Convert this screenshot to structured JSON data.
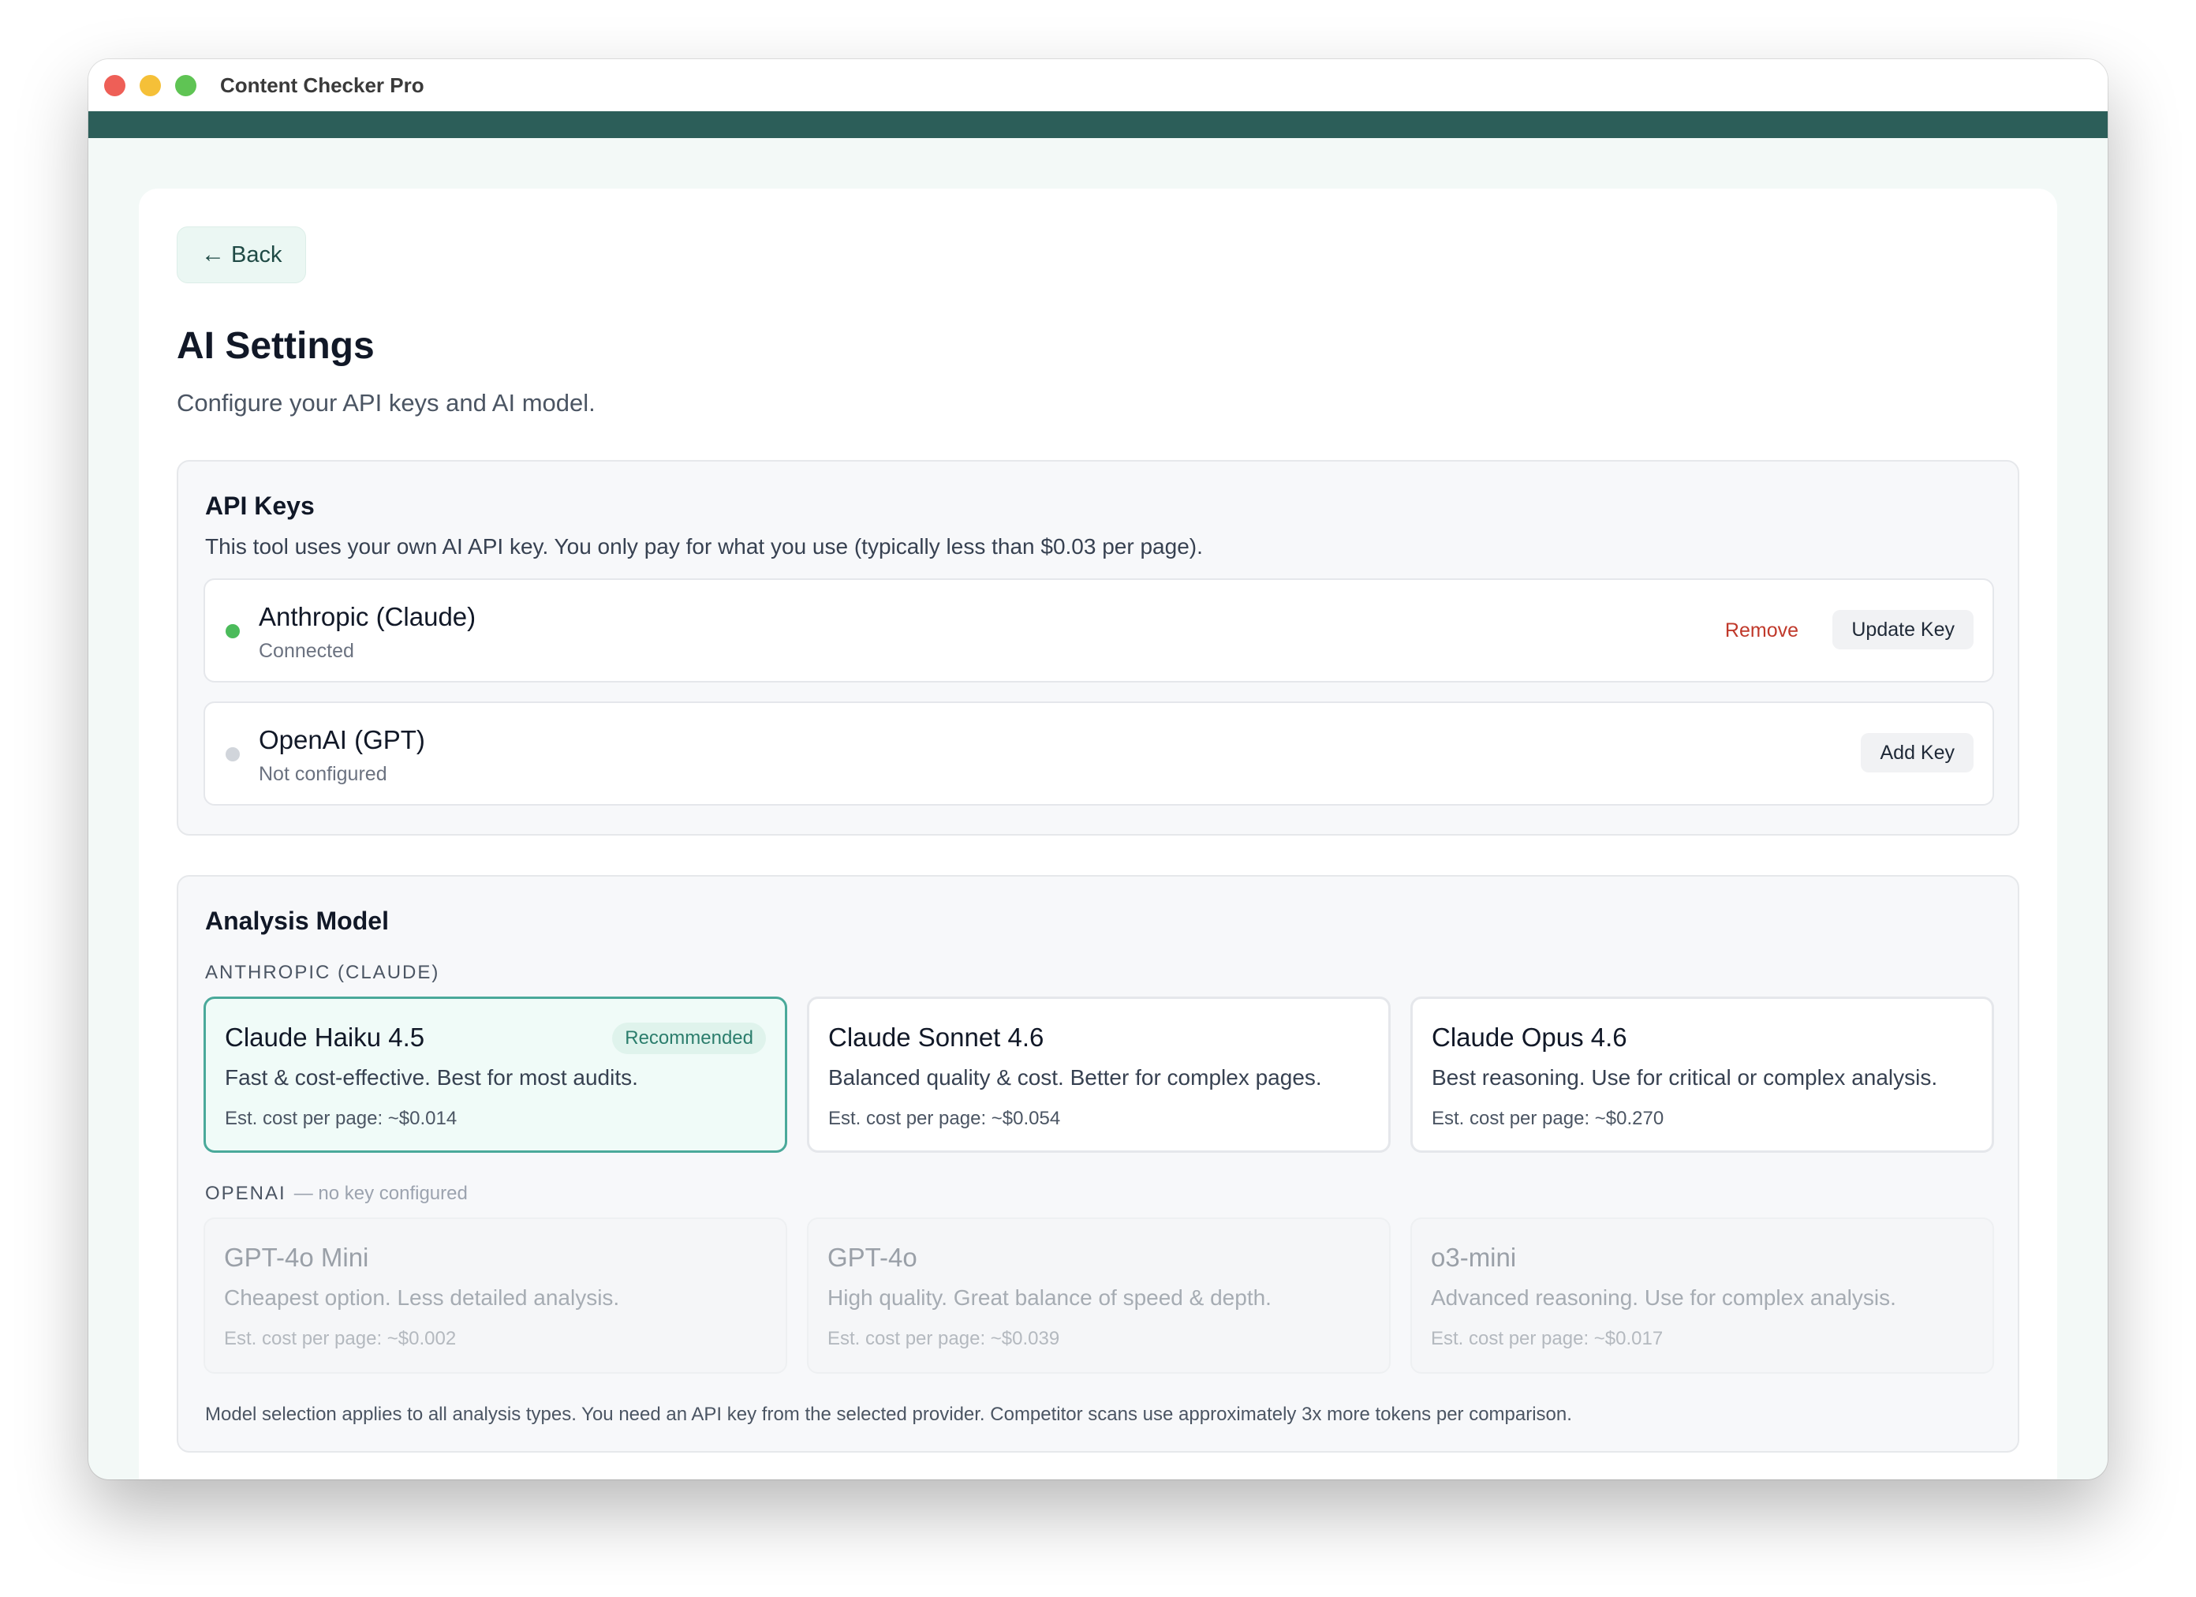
{
  "window": {
    "title": "Content Checker Pro"
  },
  "back_label": "Back",
  "page": {
    "title": "AI Settings",
    "subtitle": "Configure your API keys and AI model."
  },
  "api_keys": {
    "title": "API Keys",
    "description": "This tool uses your own AI API key. You only pay for what you use (typically less than $0.03 per page).",
    "providers": [
      {
        "name": "Anthropic (Claude)",
        "status": "Connected",
        "connected": true,
        "remove_label": "Remove",
        "action_label": "Update Key"
      },
      {
        "name": "OpenAI (GPT)",
        "status": "Not configured",
        "connected": false,
        "action_label": "Add Key"
      }
    ]
  },
  "analysis": {
    "title": "Analysis Model",
    "anthropic_group": "ANTHROPIC (CLAUDE)",
    "openai_group": "OPENAI",
    "openai_note": "— no key configured",
    "anthropic_models": [
      {
        "name": "Claude Haiku 4.5",
        "badge": "Recommended",
        "desc": "Fast & cost-effective. Best for most audits.",
        "cost": "Est. cost per page: ~$0.014",
        "selected": true
      },
      {
        "name": "Claude Sonnet 4.6",
        "desc": "Balanced quality & cost. Better for complex pages.",
        "cost": "Est. cost per page: ~$0.054"
      },
      {
        "name": "Claude Opus 4.6",
        "desc": "Best reasoning. Use for critical or complex analysis.",
        "cost": "Est. cost per page: ~$0.270"
      }
    ],
    "openai_models": [
      {
        "name": "GPT-4o Mini",
        "desc": "Cheapest option. Less detailed analysis.",
        "cost": "Est. cost per page: ~$0.002"
      },
      {
        "name": "GPT-4o",
        "desc": "High quality. Great balance of speed & depth.",
        "cost": "Est. cost per page: ~$0.039"
      },
      {
        "name": "o3-mini",
        "desc": "Advanced reasoning. Use for complex analysis.",
        "cost": "Est. cost per page: ~$0.017"
      }
    ],
    "footnote": "Model selection applies to all analysis types. You need an API key from the selected provider. Competitor scans use approximately 3x more tokens per comparison."
  },
  "colors": {
    "accent": "#2c5e59",
    "selected_border": "#4aa99a",
    "connected": "#4bbb5b",
    "danger": "#c0392b"
  }
}
